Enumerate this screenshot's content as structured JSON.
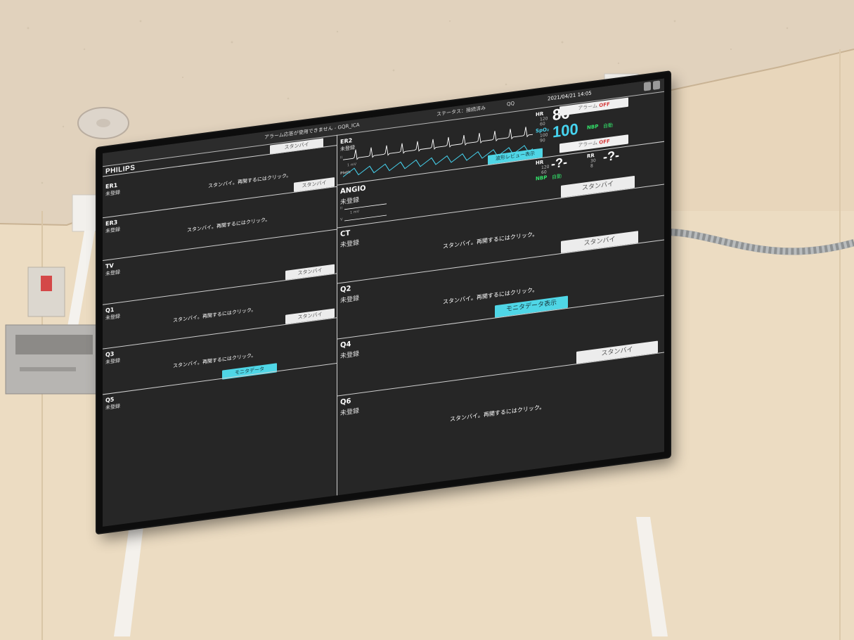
{
  "monitor": {
    "brand": "PHILIPS",
    "datetime": "2021/04/21  14:05",
    "status_label": "ステータス：接続済み",
    "qq_label": "QQ",
    "alarm_hint": "アラーム応答が使用できません - GQR_ICA",
    "top_standby_button": "スタンバイ"
  },
  "beds_left": [
    {
      "name": "ER1",
      "status": "未登録",
      "message": "スタンバイ。再開するにはクリック。",
      "button": "スタンバイ",
      "button_style": "white"
    },
    {
      "name": "ER3",
      "status": "未登録",
      "message": "スタンバイ。再開するにはクリック。",
      "button": "",
      "button_style": ""
    },
    {
      "name": "TV",
      "status": "未登録",
      "message": "",
      "button": "スタンバイ",
      "button_style": "white"
    },
    {
      "name": "Q1",
      "status": "未登録",
      "message": "スタンバイ。再開するにはクリック。",
      "button": "スタンバイ",
      "button_style": "white"
    },
    {
      "name": "Q3",
      "status": "未登録",
      "message": "スタンバイ。再開するにはクリック。",
      "button": "モニタデータ",
      "button_style": "cyan"
    },
    {
      "name": "Q5",
      "status": "未登録",
      "message": "",
      "button": "",
      "button_style": ""
    }
  ],
  "beds_right": [
    {
      "name": "ANGIO",
      "status": "未登録",
      "message": "",
      "button": "スタンバイ",
      "button_style": "white"
    },
    {
      "name": "CT",
      "status": "未登録",
      "message": "スタンバイ。再開するにはクリック。",
      "button": "スタンバイ",
      "button_style": "white"
    },
    {
      "name": "Q2",
      "status": "未登録",
      "message": "スタンバイ。再開するにはクリック。",
      "button": "モニタデータ表示",
      "button_style": "cyan"
    },
    {
      "name": "Q4",
      "status": "未登録",
      "message": "",
      "button": "スタンバイ",
      "button_style": "white"
    },
    {
      "name": "Q6",
      "status": "未登録",
      "message": "スタンバイ。再開するにはクリック。",
      "button": "",
      "button_style": ""
    }
  ],
  "er2": {
    "name": "ER2",
    "status": "未登録",
    "lead_label": "II",
    "pleth_label": "Pleth",
    "scale_label": "1 mV",
    "hr_label": "HR",
    "hr_value": "86",
    "hr_limits": [
      "120",
      "60"
    ],
    "spo2_label": "SpO₂",
    "spo2_value": "100",
    "spo2_limits": [
      "100",
      "90"
    ],
    "etco2_label": "etCO₂",
    "nbp_label": "NBP",
    "nbp_mode": "自動",
    "alarm_off_label": "アラーム",
    "alarm_off_state": "OFF",
    "review_button": "波形レビュー表示"
  },
  "angio": {
    "hr_label": "HR",
    "hr_value": "-?-",
    "hr_limits": [
      "120",
      "60"
    ],
    "rr_label": "RR",
    "rr_value": "-?-",
    "rr_limits": [
      "30",
      "8"
    ],
    "nbp_label": "NBP",
    "nbp_mode": "自動",
    "lead_ii": "II",
    "lead_v": "V",
    "scale_label": "1 mV"
  },
  "colors": {
    "screen_bg": "#262626",
    "accent_cyan": "#4fd6e6",
    "vital_green": "#33e36a",
    "alarm_red": "#d63a3a"
  }
}
